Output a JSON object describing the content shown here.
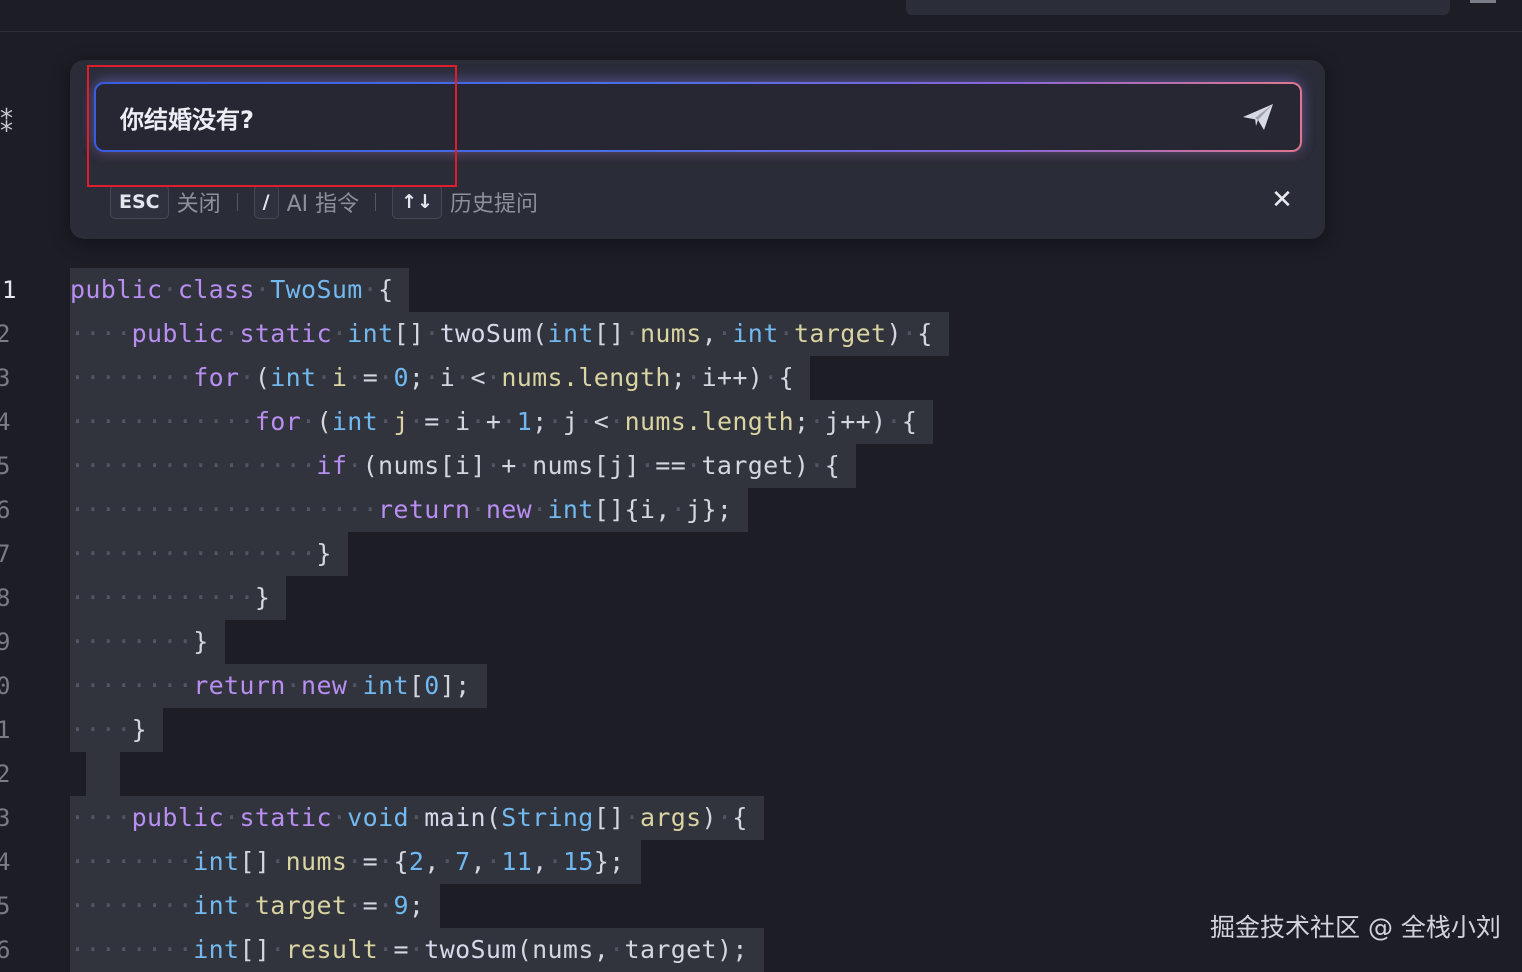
{
  "ai_prompt": {
    "input_value": "你结婚没有?",
    "hints": [
      {
        "key": "ESC",
        "label": "关闭"
      },
      {
        "key": "/",
        "label": "AI 指令"
      },
      {
        "key": "↑↓",
        "label": "历史提问"
      }
    ],
    "close_symbol": "✕",
    "send_icon": "paper-plane-icon"
  },
  "editor": {
    "line_numbers": [
      "1",
      "2",
      "3",
      "4",
      "5",
      "6",
      "7",
      "8",
      "9",
      "0",
      "1",
      "2",
      "3",
      "4",
      "5",
      "6"
    ],
    "current_line": "1",
    "language": "java"
  },
  "watermark": "掘金技术社区 @ 全栈小刘",
  "colors": {
    "background": "#1c1d25",
    "panel": "#2a2c38",
    "keyword": "#b88ef0",
    "type": "#72b9ef",
    "identifier": "#d9d4a1",
    "number": "#6fb8f0",
    "highlight_box": "#e01d2d"
  }
}
